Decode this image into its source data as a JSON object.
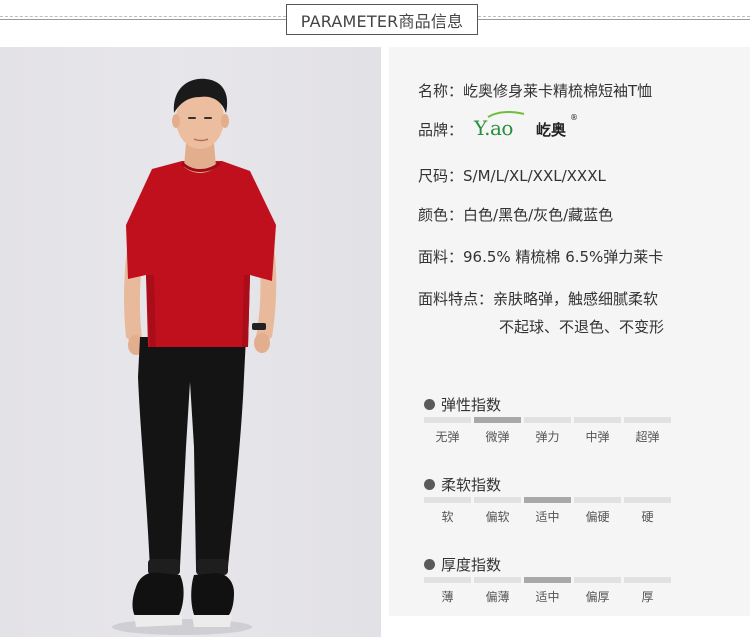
{
  "header": {
    "title": "PARAMETER商品信息"
  },
  "photo": {
    "subject": "model-wearing-red-tshirt"
  },
  "specs": {
    "name": {
      "label": "名称：",
      "value": "屹奥修身莱卡精梳棉短袖T恤"
    },
    "brand": {
      "label": "品牌：",
      "logo_text": "Y.ao",
      "logo_cn": "屹奥",
      "logo_reg": "®"
    },
    "size": {
      "label": "尺码：",
      "value": "S/M/L/XL/XXL/XXXL"
    },
    "color": {
      "label": "颜色：",
      "value": "白色/黑色/灰色/藏蓝色"
    },
    "fabric": {
      "label": "面料：",
      "value": "96.5% 精梳棉  6.5%弹力莱卡"
    },
    "features": {
      "label": "面料特点：",
      "line1": "亲肤略弹，触感细腻柔软",
      "line2": "不起球、不退色、不变形"
    }
  },
  "indices": [
    {
      "title": "弹性指数",
      "levels": [
        "无弹",
        "微弹",
        "弹力",
        "中弹",
        "超弹"
      ],
      "active": 1
    },
    {
      "title": "柔软指数",
      "levels": [
        "软",
        "偏软",
        "适中",
        "偏硬",
        "硬"
      ],
      "active": 2
    },
    {
      "title": "厚度指数",
      "levels": [
        "薄",
        "偏薄",
        "适中",
        "偏厚",
        "厚"
      ],
      "active": 2
    }
  ],
  "colors": {
    "shirt": "#c0101d",
    "active_bar": "#a8a8a8",
    "inactive_bar": "#e1e1e1",
    "logo_green": "#2a8f3c"
  }
}
